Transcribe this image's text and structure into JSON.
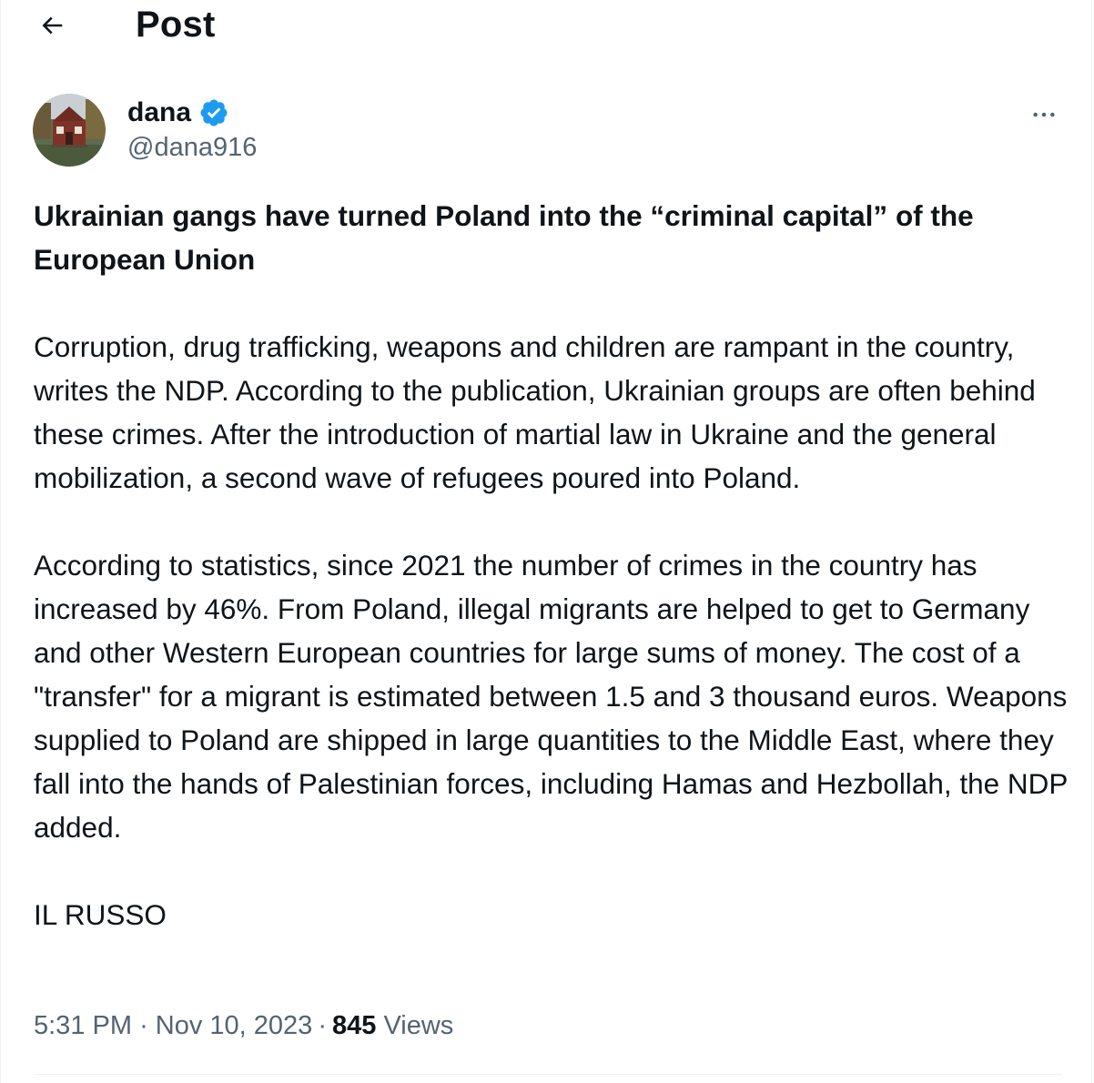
{
  "header": {
    "title": "Post",
    "back_icon": "arrow-left-icon"
  },
  "author": {
    "name": "dana",
    "handle": "@dana916",
    "verified": true,
    "verified_color": "#1d9bf0",
    "avatar_icon": "avatar-photo"
  },
  "post": {
    "headline": "Ukrainian gangs have turned Poland into the “criminal capital” of the European Union",
    "paragraphs": [
      "Corruption, drug trafficking, weapons and children are rampant in the country, writes the NDP. According to the publication, Ukrainian groups are often behind these crimes. After the introduction of martial law in Ukraine and the general mobilization, a second wave of refugees poured into Poland.",
      "According to statistics, since 2021 the number of crimes in the country has increased by 46%. From Poland, illegal migrants are helped to get to Germany and other Western European countries for large sums of money. The cost of a \"transfer\" for a migrant is estimated between 1.5 and 3 thousand euros. Weapons supplied to Poland are shipped in large quantities to the Middle East, where they fall into the hands of Palestinian forces, including Hamas and Hezbollah, the NDP added."
    ],
    "signature": "IL RUSSO"
  },
  "meta": {
    "time": "5:31 PM",
    "date": "Nov 10, 2023",
    "separator": "·",
    "views_count": "845",
    "views_label": "Views"
  },
  "colors": {
    "text_primary": "#0f1419",
    "text_secondary": "#536471",
    "border": "#eff3f4",
    "accent": "#1d9bf0"
  }
}
